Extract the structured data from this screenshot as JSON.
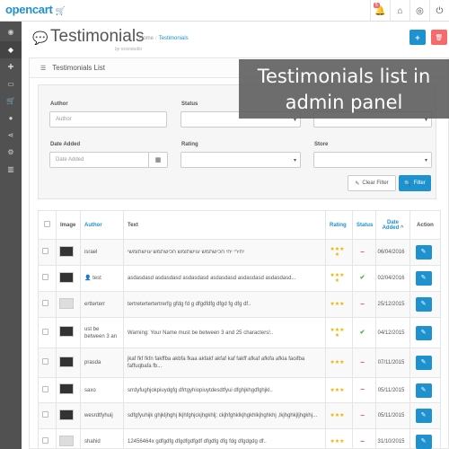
{
  "app": {
    "logo": "opencart",
    "notification_count": "5"
  },
  "page": {
    "title": "Testimonials",
    "byline": "by xxxxstudio",
    "breadcrumb": {
      "home": "Home",
      "current": "Testimonials"
    },
    "add_symbol": "+",
    "delete_symbol": "🗑"
  },
  "overlay": {
    "line1": "Testimonials list in",
    "line2": "admin panel"
  },
  "panel": {
    "title": "Testimonials List"
  },
  "filters": {
    "author_label": "Author",
    "author_placeholder": "Author",
    "status_label": "Status",
    "date_label": "Date Added",
    "date_placeholder": "Date Added",
    "rating_label": "Rating",
    "store_label": "Store",
    "clear_label": "Clear Filter",
    "filter_label": "Filter"
  },
  "table": {
    "headers": {
      "image": "Image",
      "author": "Author",
      "text": "Text",
      "rating": "Rating",
      "status": "Status",
      "date_line1": "Date",
      "date_line2": "Added ^",
      "action": "Action"
    },
    "rows": [
      {
        "author": "israel",
        "text": "יחירי יחי חכישתמש עוישתומש חכישתמש עוישתומשי",
        "rating": 4,
        "status": "disabled",
        "date": "06/04/2016"
      },
      {
        "author": "test",
        "text": "asdasdasd asdasdasd asdasdasd asdasdasd asdasdasd asdasdasd...",
        "rating": 4,
        "status": "enabled",
        "date": "02/04/2016"
      },
      {
        "author": "ertterterr",
        "text": "tertretertertertrerfg gfdg fd g dfgdfdfg dfgd fg dfg df..",
        "rating": 3,
        "status": "disabled",
        "date": "25/12/2015"
      },
      {
        "author": "ust be between 3 an",
        "text": "Warning: Your Name must be between 3 and 25 characters!..",
        "rating": 4,
        "status": "enabled",
        "date": "04/12/2015"
      },
      {
        "author": "prasda",
        "text": "jkaf fkf fkfn fakffba akbfa fkaa akfakf akfaf kaf fakff afkaf afkifa afkia faoifba faffuqbafa fb...",
        "rating": 3,
        "status": "disabled",
        "date": "07/11/2015"
      },
      {
        "author": "saxo",
        "text": "srrdyfughjokpiuydgfg dfrtgyhiopiuytdesdtfyui dfghjkhgdfghjkl..",
        "rating": 3,
        "status": "disabled",
        "date": "05/11/2015"
      },
      {
        "author": "wesrdtfyhuij",
        "text": "sdfgfyuhijk ghjkljhghj lkjhfghjckjhgkhlj; ckjhfghklkjhgkhlkjhghkhj ,lkjhghkjljhgkhj...",
        "rating": 3,
        "status": "disabled",
        "date": "05/11/2015"
      },
      {
        "author": "shahid",
        "text": "12456464x gdfgdfg dfgdfgdfgdf dfgdfg dfg fdg dfgdgdg df..",
        "rating": 3,
        "status": "disabled",
        "date": "31/10/2015"
      }
    ]
  },
  "colors": {
    "accent": "#1e91cf",
    "danger": "#f56b6b",
    "sidebar": "#515151",
    "star": "#f0b400",
    "success": "#4cae4c"
  }
}
